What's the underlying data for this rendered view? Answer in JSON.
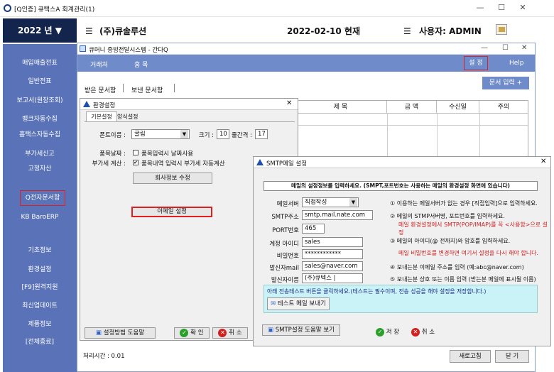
{
  "window": {
    "title": "[Q인증] 큐택스A   회계관리(1)",
    "min": "—",
    "max": "☐",
    "close": "✕"
  },
  "header": {
    "year": "2022 년 ▼",
    "company": "(주)큐솔루션",
    "date": "2022-02-10 현재",
    "user": "사용자: ADMIN"
  },
  "sidebar": {
    "items": [
      {
        "label": "매입매출전표"
      },
      {
        "label": "일반전표"
      },
      {
        "label": "보고서(원장조회)"
      },
      {
        "label": "뱅크자동수집"
      },
      {
        "label": "홈택스자동수집"
      },
      {
        "label": "부가세신고"
      },
      {
        "label": "고정자산"
      },
      {
        "label": "Q전자문서함"
      },
      {
        "label": "KB BaroERP"
      },
      {
        "label": "기초정보"
      },
      {
        "label": "환경설정"
      },
      {
        "label": "[F9]원격지원"
      },
      {
        "label": "최신업데이트"
      },
      {
        "label": "제품정보"
      },
      {
        "label": "[전체종료]"
      }
    ]
  },
  "child": {
    "title": "큐머니 증빙전달시스템 - 간다Q",
    "menu": [
      "거래처",
      "홈 목"
    ],
    "settings": "설 정",
    "help": "Help",
    "tabs": [
      "받은 문서함",
      "보낸 문서함"
    ],
    "doc_input": "문서 입력 +",
    "columns": [
      "제 목",
      "금 액",
      "수신일",
      "주의"
    ],
    "process_time": "처리시간 : 0.01",
    "refresh": "새로고침",
    "close": "닫 기"
  },
  "env": {
    "title": "환경설정",
    "tabs": [
      "기본설정",
      "양식설정"
    ],
    "font_label": "폰트이름 :",
    "font_value": "굴림",
    "size_label": "크기 :",
    "size_value": "10",
    "spacing_label": "줄간격 :",
    "spacing_value": "17",
    "item_date_label": "품목날짜 :",
    "item_date_check": "품목입력시 날짜사용",
    "vat_label": "부가세 계산 :",
    "vat_check": "품목내역 입력시 부가세 자동계산",
    "company_btn": "회사정보 수정",
    "email_btn": "이메일 설정",
    "help_btn": "설정방법 도움말",
    "ok_btn": "확 인",
    "cancel_btn": "취 소"
  },
  "smtp": {
    "title": "SMTP메일 설정",
    "banner": "메일의 설정정보를 입력하세요. (SMPT,포트번호는 사용하는 메일의 환경설정 화면에 있습니다)",
    "fields": [
      {
        "label": "메일서버",
        "value": "직접작성",
        "note": "① 이용하는 메일서버가 없는 경우 [직접입력]으로 입력하세요."
      },
      {
        "label": "SMTP주소",
        "value": "smtp.mail.nate.com",
        "note": "② 메일의 STMP서버명, 포트번호를 입력하세요."
      },
      {
        "label": "PORT번호",
        "value": "465",
        "note": "메일 환경설정에서 SMTP(POP/IMAP)를 꼭 <사용함>으로 설정"
      },
      {
        "label": "계정 아이디",
        "value": "sales",
        "note": "③ 메일의 아이디(@ 전까지)와 암호를 입력하세요."
      },
      {
        "label": "비밀번호",
        "value": "************",
        "note": "메일 비밀번호를 변경하면 여기서 설정을 다시 해야 합니다."
      },
      {
        "label": "발신자mail",
        "value": "sales@naver.com",
        "note": "④ 보내는분 이메일 주소를 입력 (예:abc@naver.com)"
      },
      {
        "label": "발신자이름",
        "value": "(주)큐텍스 |",
        "note": "⑤ 보내는분 상호 또는 이름 입력 (받는분 메일에 표시될 이름)"
      }
    ],
    "test_note": "아래 전송테스트 버튼을 클릭하세요.(테스트는 필수이며, 전송 성공을 해야 설정을 저장합니다.)",
    "test_btn": "테스트 메일 보내기",
    "help_btn": "SMTP설정 도움말 보기",
    "save_btn": "저 장",
    "cancel_btn": "취 소"
  },
  "colors": {
    "navy": "#13244d",
    "sidebar": "#5a73b8",
    "menu": "#6f8bc9",
    "red": "#d02020",
    "banner": "#c9f3f7"
  }
}
